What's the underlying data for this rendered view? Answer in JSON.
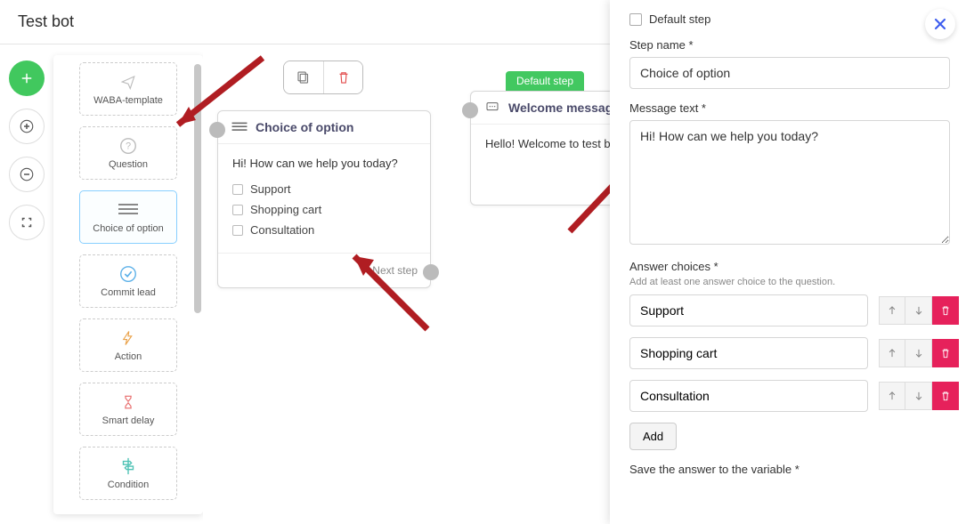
{
  "header": {
    "title": "Test bot"
  },
  "palette": {
    "items": [
      {
        "label": "WABA-template"
      },
      {
        "label": "Question"
      },
      {
        "label": "Choice of option"
      },
      {
        "label": "Commit lead"
      },
      {
        "label": "Action"
      },
      {
        "label": "Smart delay"
      },
      {
        "label": "Condition"
      }
    ]
  },
  "canvas": {
    "choice_node": {
      "title": "Choice of option",
      "text": "Hi! How can we help you today?",
      "options": [
        "Support",
        "Shopping cart",
        "Consultation"
      ],
      "footer": "Next step"
    },
    "welcome_node": {
      "badge": "Default step",
      "title": "Welcome message",
      "text": "Hello! Welcome to test bot."
    }
  },
  "panel": {
    "default_step_label": "Default step",
    "step_name_label": "Step name *",
    "step_name_value": "Choice of option",
    "message_text_label": "Message text *",
    "message_text_value": "Hi! How can we help you today?",
    "answer_choices_label": "Answer choices *",
    "answer_choices_hint": "Add at least one answer choice to the question.",
    "choices": [
      "Support",
      "Shopping cart",
      "Consultation"
    ],
    "add_button": "Add",
    "save_var_label": "Save the answer to the variable *"
  }
}
